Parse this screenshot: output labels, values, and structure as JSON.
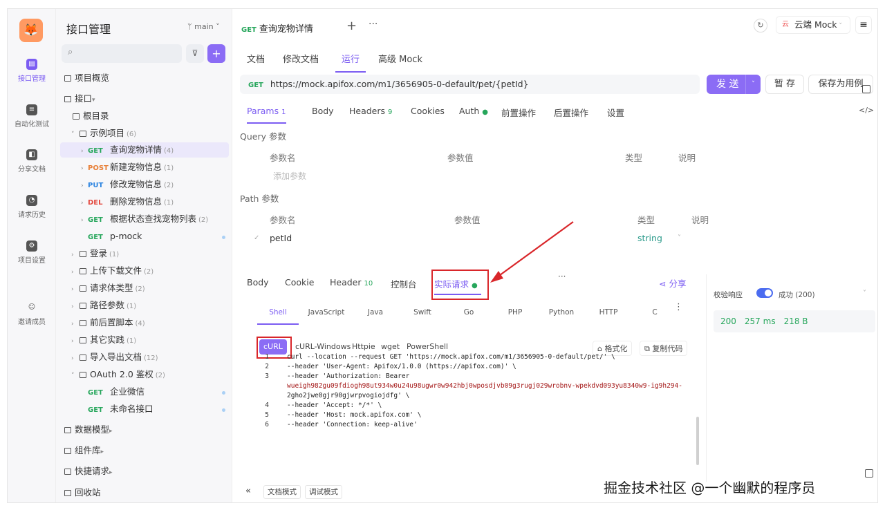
{
  "rail": [
    {
      "label": "接口管理",
      "active": true,
      "icon": "api-management-icon"
    },
    {
      "label": "自动化测试",
      "active": false,
      "icon": "automation-test-icon"
    },
    {
      "label": "分享文档",
      "active": false,
      "icon": "share-doc-icon"
    },
    {
      "label": "请求历史",
      "active": false,
      "icon": "history-icon"
    },
    {
      "label": "项目设置",
      "active": false,
      "icon": "project-settings-icon"
    },
    {
      "label": "邀请成员",
      "active": false,
      "icon": "invite-member-icon"
    }
  ],
  "tree": {
    "title": "接口管理",
    "branch": "main",
    "overview": "项目概览",
    "apis": "接口",
    "root": "根目录",
    "example_folder": {
      "name": "示例项目",
      "count": "(6)"
    },
    "endpoints": [
      {
        "method": "GET",
        "name": "查询宠物详情",
        "count": "(4)"
      },
      {
        "method": "POST",
        "name": "新建宠物信息",
        "count": "(1)"
      },
      {
        "method": "PUT",
        "name": "修改宠物信息",
        "count": "(2)"
      },
      {
        "method": "DEL",
        "name": "删除宠物信息",
        "count": "(1)"
      },
      {
        "method": "GET",
        "name": "根据状态查找宠物列表",
        "count": "(2)"
      },
      {
        "method": "GET",
        "name": "p-mock",
        "count": ""
      }
    ],
    "folders": [
      {
        "name": "登录",
        "count": "(1)"
      },
      {
        "name": "上传下载文件",
        "count": "(2)"
      },
      {
        "name": "请求体类型",
        "count": "(2)"
      },
      {
        "name": "路径参数",
        "count": "(1)"
      },
      {
        "name": "前后置脚本",
        "count": "(4)"
      },
      {
        "name": "其它实践",
        "count": "(1)"
      },
      {
        "name": "导入导出文档",
        "count": "(12)"
      }
    ],
    "oauth": {
      "name": "OAuth 2.0 鉴权",
      "count": "(2)"
    },
    "oauth_items": [
      {
        "method": "GET",
        "name": "企业微信"
      },
      {
        "method": "GET",
        "name": "未命名接口"
      }
    ],
    "data_model": "数据模型",
    "components": "组件库",
    "quick_request": "快捷请求",
    "recycle": "回收站"
  },
  "top": {
    "tab_method": "GET",
    "tab_title": "查询宠物详情",
    "env": "云端 Mock",
    "env_prefix": "云"
  },
  "subtabs": [
    "文档",
    "修改文档",
    "运行",
    "高级 Mock"
  ],
  "request": {
    "method": "GET",
    "url": "https://mock.apifox.com/m1/3656905-0-default/pet/{petId}",
    "send": "发 送",
    "save": "暂 存",
    "save_case": "保存为用例"
  },
  "param_tabs": [
    {
      "label": "Params",
      "badge": "1"
    },
    {
      "label": "Body",
      "badge": ""
    },
    {
      "label": "Headers",
      "badge": "9"
    },
    {
      "label": "Cookies",
      "badge": ""
    },
    {
      "label": "Auth",
      "badge": "●"
    },
    {
      "label": "前置操作",
      "badge": ""
    },
    {
      "label": "后置操作",
      "badge": ""
    },
    {
      "label": "设置",
      "badge": ""
    }
  ],
  "query": {
    "section": "Query 参数",
    "cols": [
      "参数名",
      "参数值",
      "类型",
      "说明"
    ],
    "add_hint": "添加参数"
  },
  "path": {
    "section": "Path 参数",
    "cols": [
      "参数名",
      "参数值",
      "类型",
      "说明"
    ],
    "row": {
      "name": "petId",
      "type": "string"
    }
  },
  "resp_tabs": [
    {
      "label": "Body",
      "badge": ""
    },
    {
      "label": "Cookie",
      "badge": ""
    },
    {
      "label": "Header",
      "badge": "10"
    },
    {
      "label": "控制台",
      "badge": ""
    },
    {
      "label": "实际请求",
      "badge": "●"
    }
  ],
  "share": "分享",
  "langs": [
    "Shell",
    "JavaScript",
    "Java",
    "Swift",
    "Go",
    "PHP",
    "Python",
    "HTTP",
    "C"
  ],
  "code_tabs": [
    "cURL",
    "cURL-Windows",
    "Httpie",
    "wget",
    "PowerShell"
  ],
  "format": "格式化",
  "copy": "复制代码",
  "code_lines": [
    {
      "n": "1",
      "text": "curl --location --request GET 'https://mock.apifox.com/m1/3656905-0-default/pet/' \\"
    },
    {
      "n": "2",
      "text": "--header 'User-Agent: Apifox/1.0.0 (https://apifox.com)' \\"
    },
    {
      "n": "3",
      "text": "--header 'Authorization: Bearer"
    },
    {
      "n": "",
      "text": "wueigh982gu09fdiogh98ut934w0u24u98ugwr0w942hbj0wposdjvb09g3rugj029wrobnv-wpekdvd093yu8340w9-ig9h294-"
    },
    {
      "n": "",
      "text": "2gho2jwe0gjr90gjwrpvogiojdfg' \\"
    },
    {
      "n": "4",
      "text": "--header 'Accept: */*' \\"
    },
    {
      "n": "5",
      "text": "--header 'Host: mock.apifox.com' \\"
    },
    {
      "n": "6",
      "text": "--header 'Connection: keep-alive'"
    }
  ],
  "validate": {
    "label": "校验响应",
    "result": "成功 (200)",
    "status": "200",
    "time": "257 ms",
    "size": "218 B"
  },
  "bottom": {
    "doc_mode": "文档模式",
    "debug_mode": "调试模式"
  },
  "watermark": "掘金技术社区 @一个幽默的程序员",
  "colors": {
    "accent": "#7b5cf2",
    "get": "#26a65b",
    "post": "#e8813a",
    "put": "#2c84e0",
    "del": "#e3463c",
    "highlight": "#d9262a"
  }
}
